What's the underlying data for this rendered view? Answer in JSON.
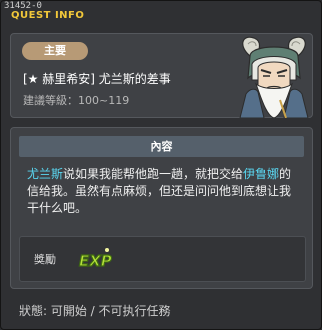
{
  "window": {
    "quest_id": "31452-0",
    "title": "QUEST INFO"
  },
  "summary": {
    "badge": "主要",
    "quest_name": "[★ 赫里希安] 尤兰斯的差事",
    "level_range": "建議等級：100~119",
    "portrait_icon": "old-sage-npc-portrait"
  },
  "content": {
    "header": "內容",
    "description_parts": {
      "npc1": "尤兰斯",
      "text1": "说如果我能帮他跑一趟，就把交给",
      "npc2": "伊鲁娜",
      "text2": "的信给我。虽然有点麻烦，但还是问问他到底想让我干什么吧。"
    },
    "highlight_color": "#5ad8f2"
  },
  "reward": {
    "label": "獎勵",
    "icon": "exp-icon",
    "icon_text": "EXP"
  },
  "status": {
    "text": "狀態: 可開始 / 不可执行任務"
  }
}
